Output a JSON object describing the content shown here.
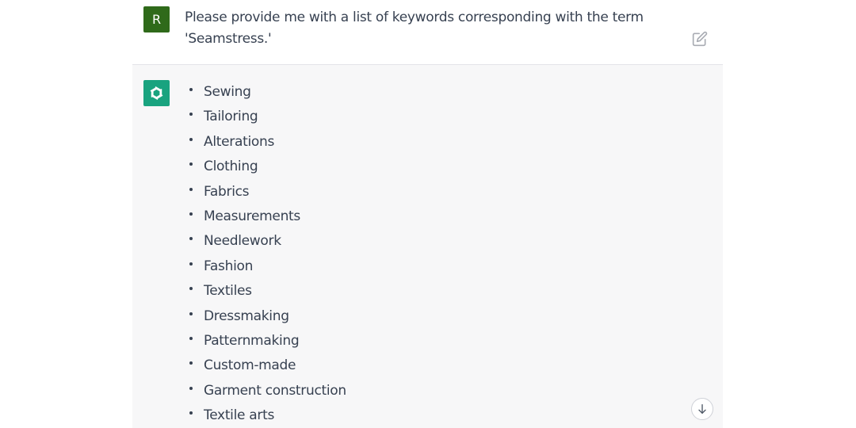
{
  "user": {
    "avatar_letter": "R",
    "avatar_color": "#2f6a1a",
    "message": "Please provide me with a list of keywords corresponding with the term 'Seamstress.'",
    "edit_icon": "edit-icon"
  },
  "assistant": {
    "avatar_icon": "openai-logo-icon",
    "avatar_color": "#19a37f",
    "keywords": [
      "Sewing",
      "Tailoring",
      "Alterations",
      "Clothing",
      "Fabrics",
      "Measurements",
      "Needlework",
      "Fashion",
      "Textiles",
      "Dressmaking",
      "Patternmaking",
      "Custom-made",
      "Garment construction",
      "Textile arts"
    ]
  },
  "scroll_button": {
    "icon": "arrow-down-icon"
  }
}
